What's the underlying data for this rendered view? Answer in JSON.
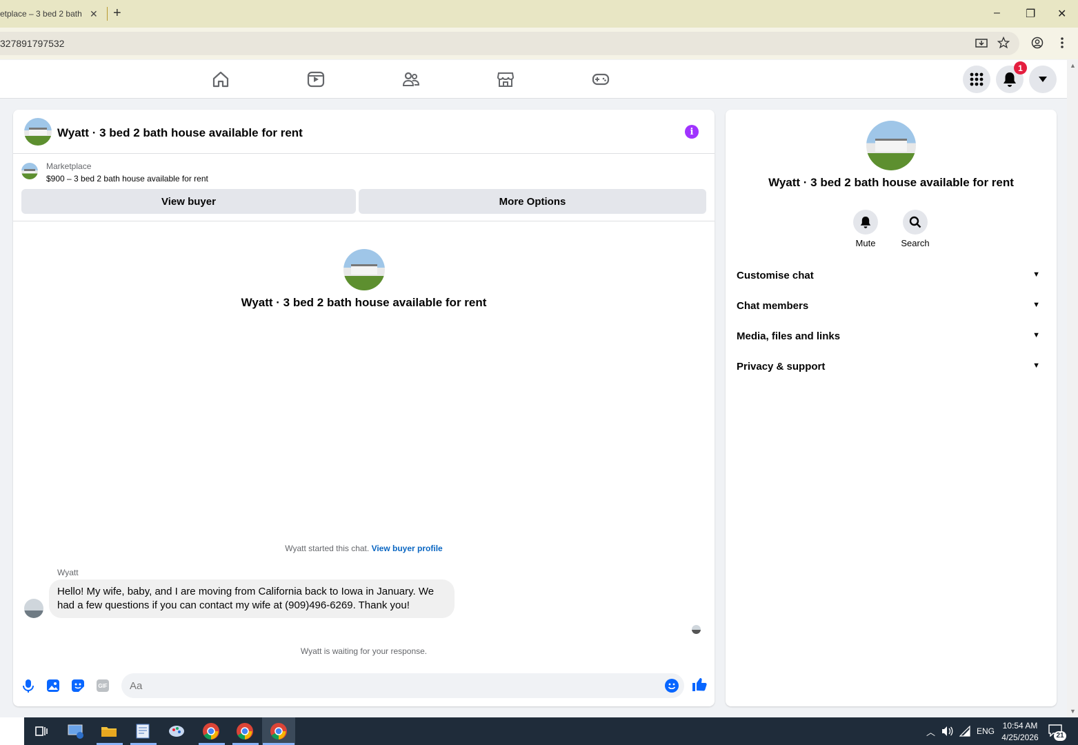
{
  "browser": {
    "tab_title": "etplace – 3 bed 2 bath h",
    "tab_close": "✕",
    "new_tab": "+",
    "url": "327891797532",
    "window_controls": [
      "–",
      "❐",
      "✕"
    ]
  },
  "fb_nav": {
    "notification_count": "1",
    "icons": [
      "home-icon",
      "video-icon",
      "friends-icon",
      "marketplace-icon",
      "gaming-icon"
    ]
  },
  "chat": {
    "title": "Wyatt · 3 bed 2 bath house available for rent",
    "info_label": "i",
    "marketplace_label": "Marketplace",
    "listing": "$900 – 3 bed 2 bath house available for rent",
    "view_buyer": "View buyer",
    "more_options": "More Options",
    "center_name": "Wyatt · 3 bed 2 bath house available for rent",
    "started_text": "Wyatt started this chat.",
    "view_buyer_profile": "View buyer profile",
    "sender": "Wyatt",
    "message": "Hello! My wife, baby, and I are moving from California back to Iowa in January. We had a few questions if you can contact my wife at (909)496-6269. Thank you!",
    "waiting": "Wyatt is waiting for your response.",
    "input_placeholder": "Aa",
    "gif_label": "GIF"
  },
  "side": {
    "name": "Wyatt · 3 bed 2 bath house available for rent",
    "mute": "Mute",
    "search": "Search",
    "sections": [
      "Customise chat",
      "Chat members",
      "Media, files and links",
      "Privacy & support"
    ]
  },
  "taskbar": {
    "lang": "ENG",
    "time": "10:54 AM",
    "date": "4/25/2026",
    "notif": "21"
  },
  "colors": {
    "accent": "#0866ff",
    "info": "#a033ff",
    "badge": "#e41e3f"
  }
}
